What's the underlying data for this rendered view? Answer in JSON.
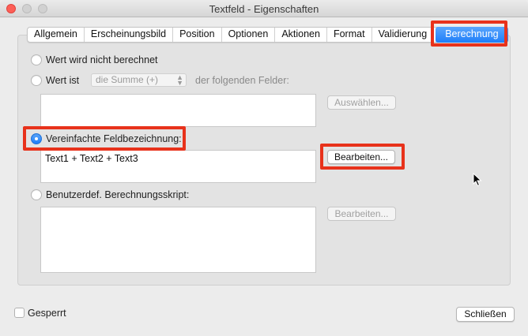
{
  "window": {
    "title": "Textfeld - Eigenschaften"
  },
  "tabs": [
    {
      "label": "Allgemein"
    },
    {
      "label": "Erscheinungsbild"
    },
    {
      "label": "Position"
    },
    {
      "label": "Optionen"
    },
    {
      "label": "Aktionen"
    },
    {
      "label": "Format"
    },
    {
      "label": "Validierung"
    },
    {
      "label": "Berechnung",
      "active": true
    }
  ],
  "calc": {
    "option_none": "Wert wird nicht berechnet",
    "option_value": "Wert ist",
    "value_select": "die Summe (+)",
    "value_suffix": "der folgenden Felder:",
    "select_button": "Auswählen...",
    "option_simplified": "Vereinfachte Feldbezeichnung:",
    "simplified_value": "Text1 + Text2 + Text3",
    "edit_button_simplified": "Bearbeiten...",
    "option_script": "Benutzerdef. Berechnungsskript:",
    "edit_button_script": "Bearbeiten...",
    "selected_option": "Vereinfachte Feldbezeichnung"
  },
  "footer": {
    "locked_label": "Gesperrt",
    "locked_checked": false,
    "close_button": "Schließen"
  },
  "colors": {
    "accent": "#1e7ef9",
    "highlight": "#e8321b"
  }
}
